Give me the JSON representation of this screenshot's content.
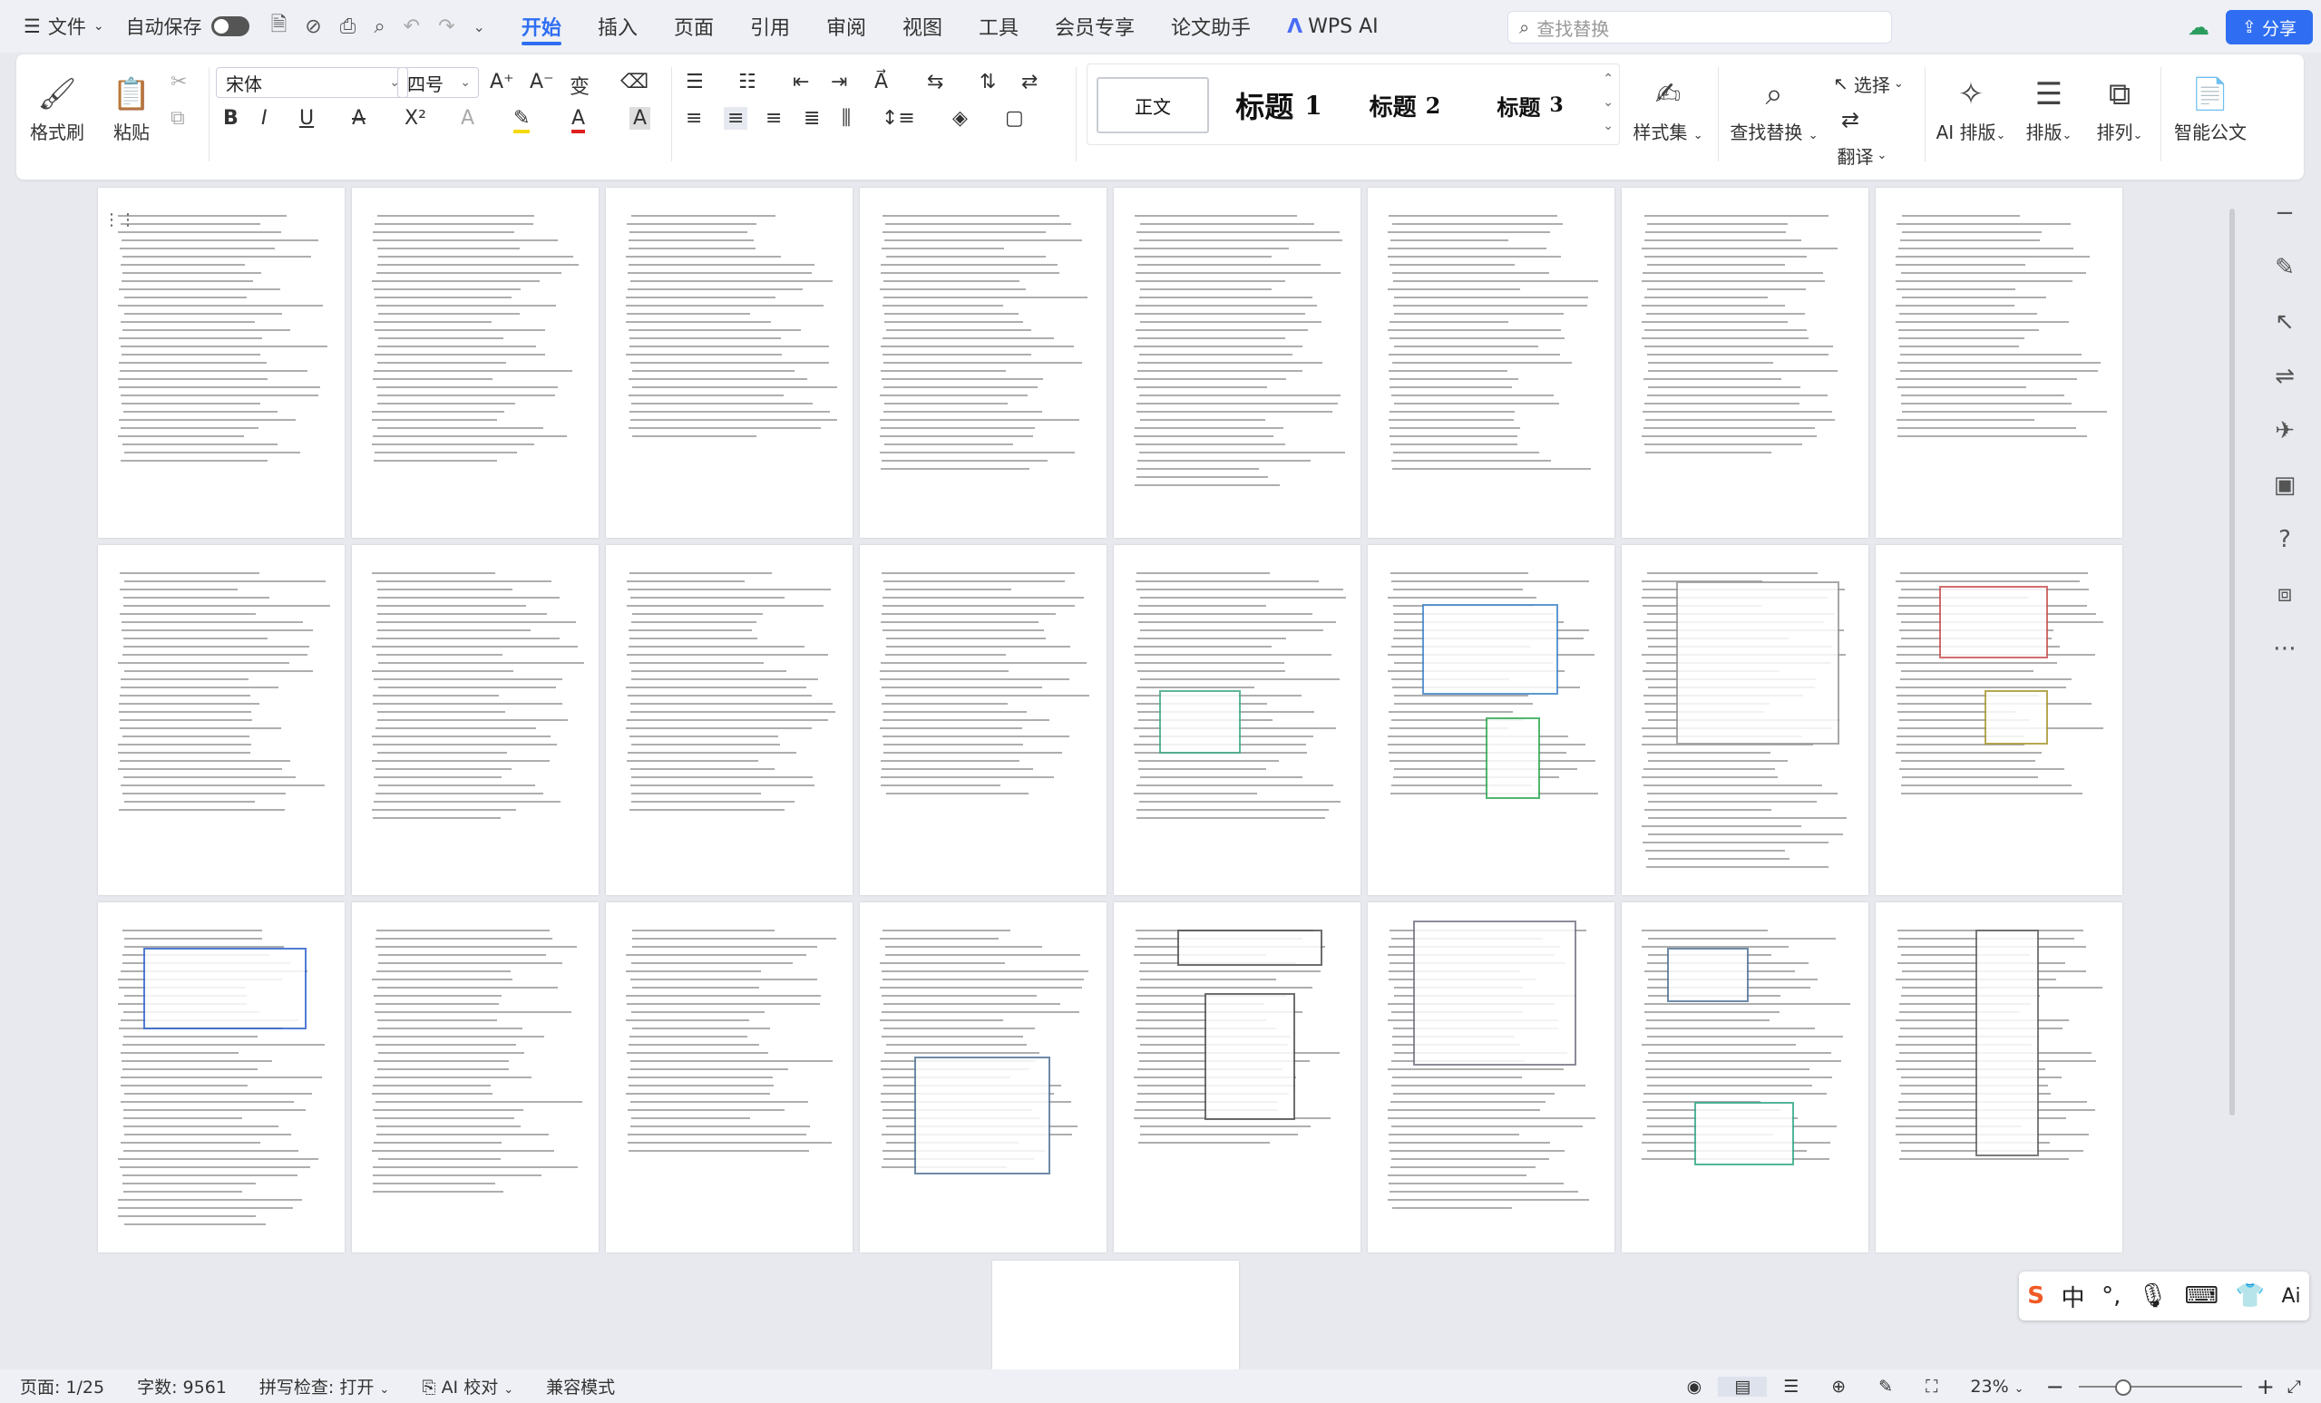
{
  "topbar": {
    "menu_file": "文件",
    "autosave_label": "自动保存",
    "tabs": [
      "开始",
      "插入",
      "页面",
      "引用",
      "审阅",
      "视图",
      "工具",
      "会员专享",
      "论文助手"
    ],
    "wps_ai": "WPS AI",
    "search_placeholder": "查找替换",
    "share": "分享"
  },
  "ribbon": {
    "format_painter": "格式刷",
    "paste": "粘贴",
    "font_name": "宋体",
    "font_size": "四号",
    "styles": {
      "normal": "正文",
      "h": "标题",
      "h1": "标题 1",
      "h2": "标题 2",
      "h3": "标题 3",
      "one": "1",
      "two": "2",
      "three": "3"
    },
    "style_set": "样式集",
    "find_replace": "查找替换",
    "select": "选择",
    "translate": "翻译",
    "ai_layout": "AI 排版",
    "layout": "排版",
    "arrange": "排列",
    "smart_doc": "智能公文"
  },
  "status": {
    "page": "页面: 1/25",
    "words": "字数: 9561",
    "spell": "拼写检查: 打开",
    "ai_check": "AI 校对",
    "compat": "兼容模式",
    "zoom": "23%"
  },
  "ime": {
    "cn": "中"
  }
}
